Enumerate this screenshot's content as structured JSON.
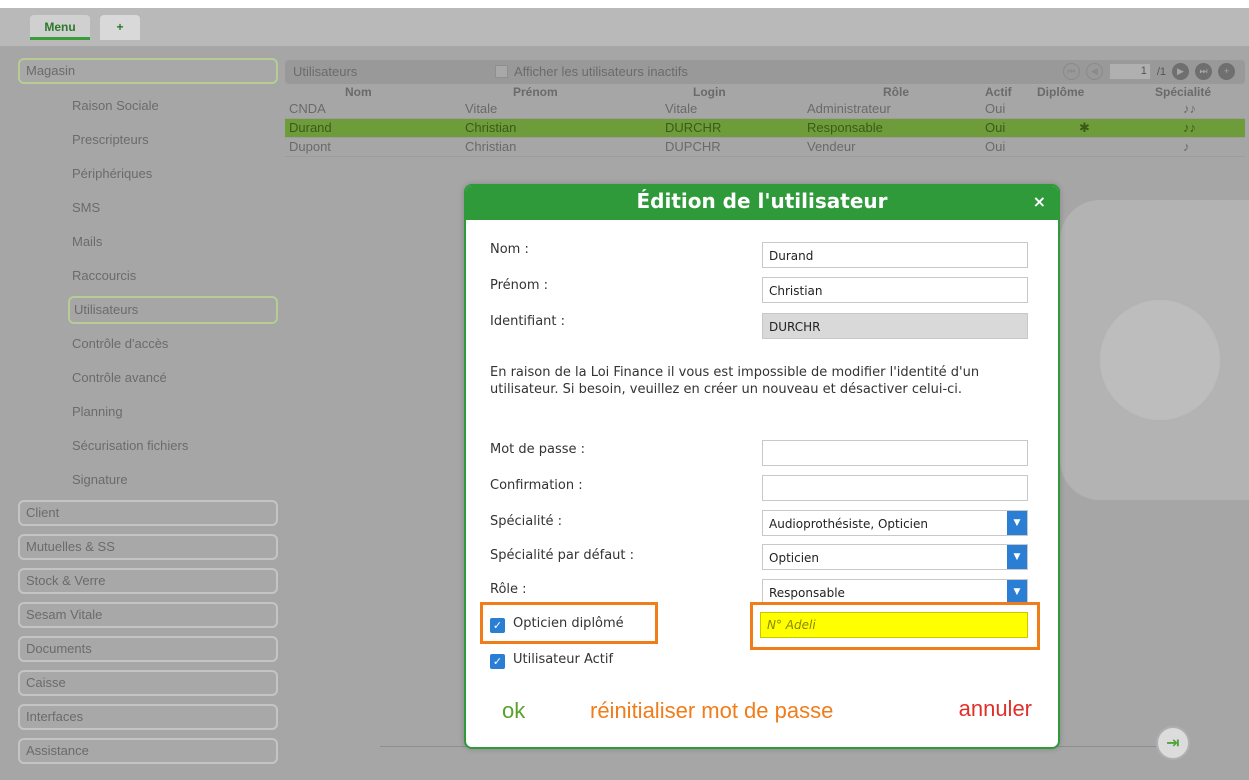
{
  "tabs": {
    "menu": "Menu",
    "plus": "+"
  },
  "sidebar": {
    "magasin": "Magasin",
    "sub": [
      "Raison Sociale",
      "Prescripteurs",
      "Périphériques",
      "SMS",
      "Mails",
      "Raccourcis",
      "Utilisateurs",
      "Contrôle d'accès",
      "Contrôle avancé",
      "Planning",
      "Sécurisation fichiers",
      "Signature"
    ],
    "categories": [
      "Client",
      "Mutuelles & SS",
      "Stock & Verre",
      "Sesam Vitale",
      "Documents",
      "Caisse",
      "Interfaces",
      "Assistance"
    ]
  },
  "users": {
    "title": "Utilisateurs",
    "inactive_label": "Afficher les utilisateurs inactifs",
    "page": "1",
    "total": "/1",
    "columns": [
      "Nom",
      "Prénom",
      "Login",
      "Rôle",
      "Actif",
      "Diplôme",
      "Spécialité"
    ],
    "rows": [
      {
        "nom": "CNDA",
        "prenom": "Vitale",
        "login": "Vitale",
        "role": "Administrateur",
        "actif": "Oui",
        "diplome": ""
      },
      {
        "nom": "Durand",
        "prenom": "Christian",
        "login": "DURCHR",
        "role": "Responsable",
        "actif": "Oui",
        "diplome": "✱"
      },
      {
        "nom": "Dupont",
        "prenom": "Christian",
        "login": "DUPCHR",
        "role": "Vendeur",
        "actif": "Oui",
        "diplome": ""
      }
    ]
  },
  "dialog": {
    "title": "Édition de l'utilisateur",
    "close": "×",
    "nom_label": "Nom :",
    "nom_value": "Durand",
    "prenom_label": "Prénom :",
    "prenom_value": "Christian",
    "identifiant_label": "Identifiant :",
    "identifiant_value": "DURCHR",
    "notice": "En raison de la Loi Finance il vous est impossible de modifier l'identité d'un utilisateur. Si besoin, veuillez en créer un nouveau et désactiver celui-ci.",
    "mdp_label": "Mot de passe :",
    "confirmation_label": "Confirmation :",
    "specialite_label": "Spécialité :",
    "specialite_value": "Audioprothésiste, Opticien",
    "specialite_defaut_label": "Spécialité par défaut :",
    "specialite_defaut_value": "Opticien",
    "role_label": "Rôle :",
    "role_value": "Responsable",
    "opticien_diplome_label": "Opticien diplômé",
    "adeli_placeholder": "N° Adeli",
    "utilisateur_actif_label": "Utilisateur Actif",
    "ok": "ok",
    "reset": "réinitialiser mot de passe",
    "cancel": "annuler"
  },
  "colors": {
    "accent": "#2e9a3a",
    "highlight": "#f07c1a",
    "adeli_bg": "#ffff00",
    "checkbox": "#2a7fd4"
  }
}
